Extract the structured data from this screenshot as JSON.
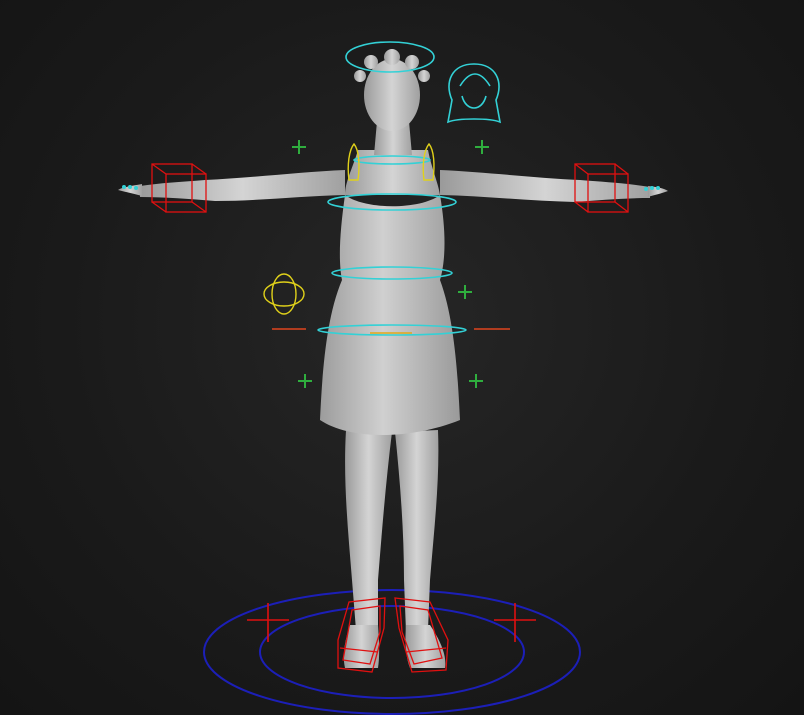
{
  "scene": {
    "background_color": "#1a1a1a",
    "mesh_color": "#c9c9c9",
    "colors": {
      "ik_fk_controls": "#33d1d6",
      "limb_controls": "#e01010",
      "secondary_controls": "#e0d11a",
      "pole_vectors": "#2fae3e",
      "root_control": "#1c1fb8",
      "hip_pivot": "#e0451e"
    },
    "icons": [
      "halo-ring-icon",
      "face-control-icon",
      "hand-cube-icon",
      "foot-cage-icon",
      "pole-vector-cross-icon",
      "root-circle-icon",
      "pivot-orb-icon"
    ]
  }
}
